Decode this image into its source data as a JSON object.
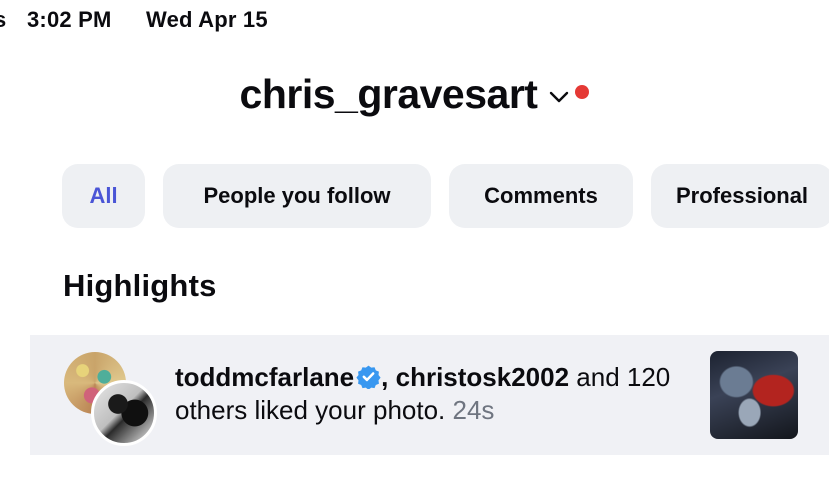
{
  "status_bar": {
    "partial_text": "s",
    "time": "3:02 PM",
    "date": "Wed Apr 15"
  },
  "header": {
    "account_name": "chris_gravesart",
    "chevron_icon": "chevron-down-icon",
    "notification_dot_color": "#e53935"
  },
  "filters": [
    {
      "label": "All",
      "active": true
    },
    {
      "label": "People you follow",
      "active": false
    },
    {
      "label": "Comments",
      "active": false
    },
    {
      "label": "Professional",
      "active": false
    }
  ],
  "colors": {
    "chip_background": "#eef0f3",
    "active_chip_text": "#4a55d6",
    "row_background": "#f0f1f5",
    "verified_badge": "#3897f0",
    "timestamp": "#6f7580"
  },
  "highlights": {
    "title": "Highlights",
    "notification": {
      "user1": "toddmcfarlane",
      "user1_verified": true,
      "separator": ", ",
      "user2": "christosk2002",
      "message": " and 120 others liked your photo.",
      "timestamp": " 24s"
    }
  }
}
